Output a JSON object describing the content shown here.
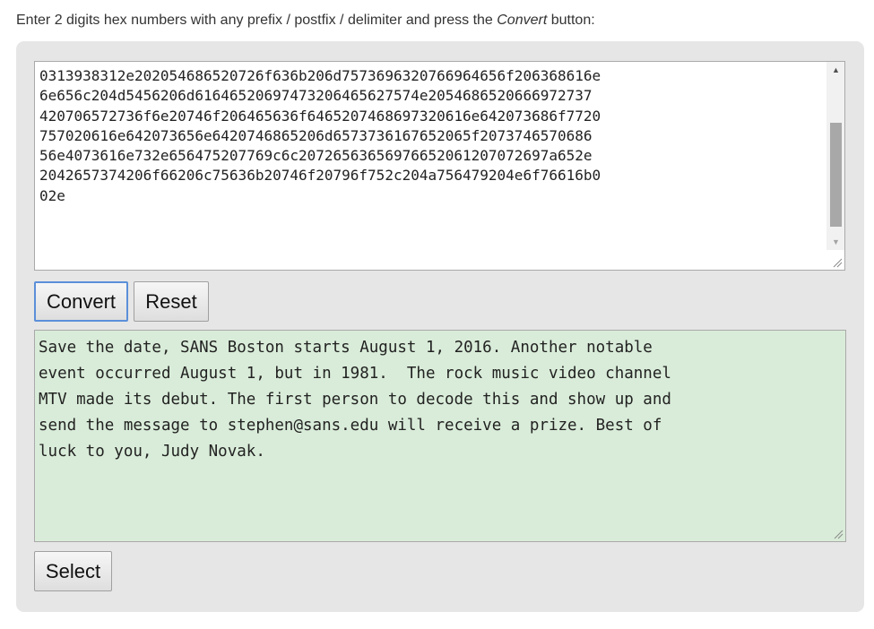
{
  "instruction": {
    "before": "Enter 2 digits hex numbers with any prefix / postfix / delimiter and press the ",
    "emphasis": "Convert",
    "after": " button:"
  },
  "hex_input": {
    "value": "0313938312e202054686520726f636b206d7573696320766964656f206368616e\n6e656c204d5456206d61646520697473206465627574e2054686520666972737\n420706572736f6e20746f206465636f6465207468697320616e642073686f7720\n757020616e642073656e6420746865206d6573736167652065f2073746570686\n56e4073616e732e656475207769c6c20726563656976652061207072697a652e\n2042657374206f66206c75636b20746f20796f752c204a756479204e6f76616b0\n02e"
  },
  "buttons": {
    "convert": "Convert",
    "reset": "Reset",
    "select": "Select"
  },
  "output": {
    "value": "Save the date, SANS Boston starts August 1, 2016. Another notable\nevent occurred August 1, but in 1981.  The rock music video channel\nMTV made its debut. The first person to decode this and show up and\nsend the message to stephen@sans.edu will receive a prize. Best of\nluck to you, Judy Novak."
  },
  "icons": {
    "scroll_up": "triangle-up-icon",
    "scroll_down": "triangle-down-icon",
    "resize": "resize-grip-icon"
  },
  "colors": {
    "panel_bg": "#e6e6e6",
    "output_bg": "#d9ecd9",
    "focus_border": "#5b8fd9"
  }
}
